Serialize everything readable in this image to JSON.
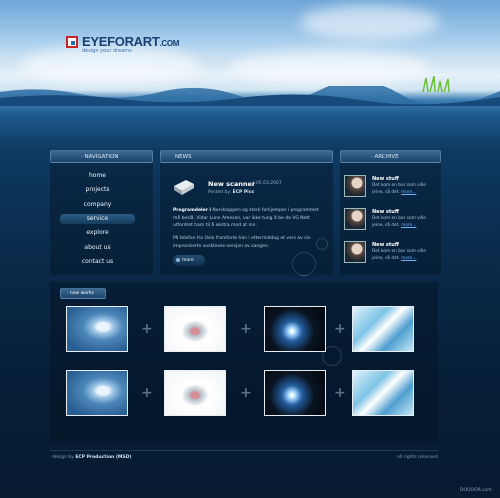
{
  "brand": {
    "name": "EYEFORART",
    "tld": ".COM",
    "tagline": "design your dreams",
    "colors": {
      "red": "#c8242a",
      "blue": "#1c3f73"
    }
  },
  "navigation": {
    "title": "NAVIGATION",
    "items": [
      {
        "label": "home",
        "active": false
      },
      {
        "label": "projects",
        "active": false
      },
      {
        "label": "company",
        "active": false
      },
      {
        "label": "service",
        "active": true
      },
      {
        "label": "explore",
        "active": false
      },
      {
        "label": "about us",
        "active": false
      },
      {
        "label": "contact us",
        "active": false
      }
    ]
  },
  "news": {
    "title": "NEWS",
    "headline": "New scanner",
    "date": "|   05.03.2007",
    "posted_prefix": "Posted by:",
    "posted_by": "ECP Pics",
    "lead": "Programdeler i",
    "paragraph1": "Norskloppen og sterk forkjemper i programmet må beslå, Vidar Lunn Amesen, var ikke tung å be da VG Nett utfordret ham til å ekstra mod at inn.",
    "paragraph2": "På telefon fra Oslo framforte han i ettermiddag et vers av sin improviserte avskleves-versjon av sangen.",
    "more_label": "more"
  },
  "archive": {
    "title": "ARCHIVE",
    "items": [
      {
        "title": "New stuff",
        "text": "Det kom en bar som ville jeine, så det.",
        "more": "more..."
      },
      {
        "title": "New stuff",
        "text": "Det kom en bar som ville jeine, så det.",
        "more": "more..."
      },
      {
        "title": "New stuff",
        "text": "Det kom en bar som ville jeine, så det.",
        "more": "more..."
      }
    ]
  },
  "works": {
    "title": "new works",
    "rows": [
      [
        {
          "icon": "face-headphones-image"
        },
        {
          "icon": "lips-image"
        },
        {
          "icon": "space-explosion-image"
        },
        {
          "icon": "aqua-landscape-image"
        }
      ],
      [
        {
          "icon": "face-headphones-image"
        },
        {
          "icon": "lips-image"
        },
        {
          "icon": "space-explosion-image"
        },
        {
          "icon": "aqua-landscape-image"
        }
      ]
    ],
    "separator": "+"
  },
  "footer": {
    "credit_prefix": "design by",
    "credit_name": "ECP Production (MSD)",
    "rights": "all rights reserved"
  },
  "watermark": "DOOOOR.com"
}
